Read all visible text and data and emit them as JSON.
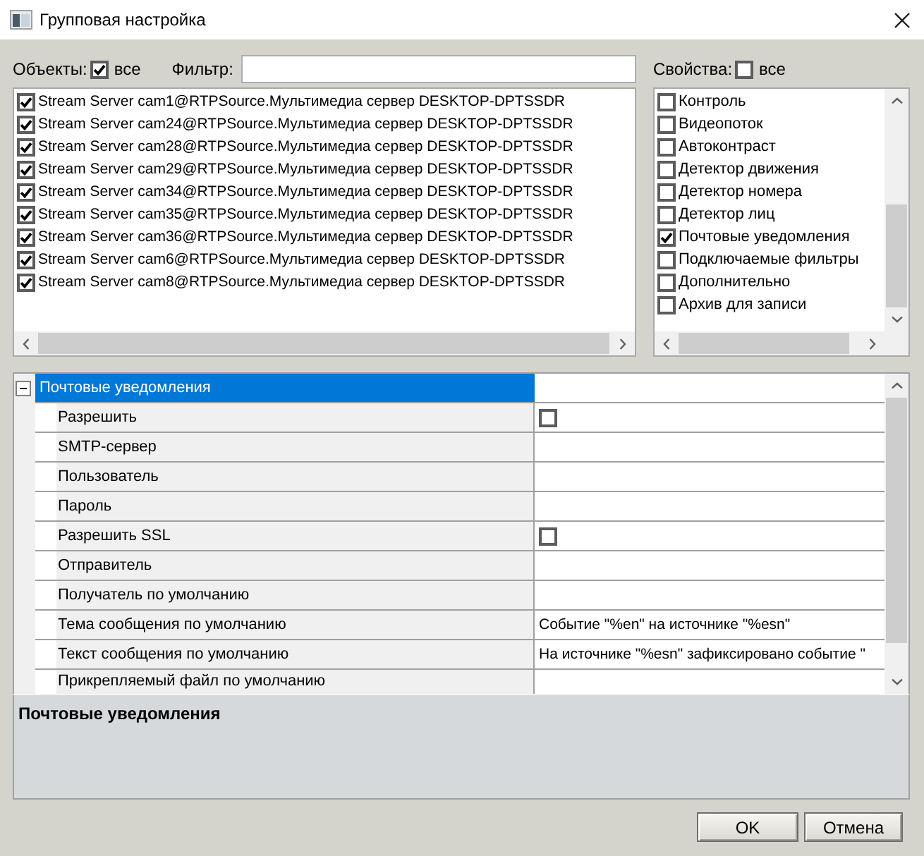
{
  "window": {
    "title": "Групповая настройка"
  },
  "objects": {
    "label": "Объекты:",
    "all": {
      "label": "все",
      "checked": true
    },
    "filter": {
      "label": "Фильтр:"
    },
    "items": [
      {
        "label": "Stream Server cam1@RTPSource.Мультимедиа сервер DESKTOP-DPTSSDR",
        "checked": true
      },
      {
        "label": "Stream Server cam24@RTPSource.Мультимедиа сервер DESKTOP-DPTSSDR",
        "checked": true
      },
      {
        "label": "Stream Server cam28@RTPSource.Мультимедиа сервер DESKTOP-DPTSSDR",
        "checked": true
      },
      {
        "label": "Stream Server cam29@RTPSource.Мультимедиа сервер DESKTOP-DPTSSDR",
        "checked": true
      },
      {
        "label": "Stream Server cam34@RTPSource.Мультимедиа сервер DESKTOP-DPTSSDR",
        "checked": true
      },
      {
        "label": "Stream Server cam35@RTPSource.Мультимедиа сервер DESKTOP-DPTSSDR",
        "checked": true
      },
      {
        "label": "Stream Server cam36@RTPSource.Мультимедиа сервер DESKTOP-DPTSSDR",
        "checked": true
      },
      {
        "label": "Stream Server cam6@RTPSource.Мультимедиа сервер DESKTOP-DPTSSDR",
        "checked": true
      },
      {
        "label": "Stream Server cam8@RTPSource.Мультимедиа сервер DESKTOP-DPTSSDR",
        "checked": true
      }
    ]
  },
  "properties": {
    "label": "Свойства:",
    "all": {
      "label": "все",
      "checked": false
    },
    "items": [
      {
        "label": "Контроль",
        "checked": false
      },
      {
        "label": "Видеопоток",
        "checked": false
      },
      {
        "label": "Автоконтраст",
        "checked": false
      },
      {
        "label": "Детектор движения",
        "checked": false
      },
      {
        "label": "Детектор номера",
        "checked": false
      },
      {
        "label": "Детектор лиц",
        "checked": false
      },
      {
        "label": "Почтовые уведомления",
        "checked": true
      },
      {
        "label": "Подключаемые фильтры",
        "checked": false
      },
      {
        "label": "Дополнительно",
        "checked": false
      },
      {
        "label": "Архив для записи",
        "checked": false
      }
    ]
  },
  "property_grid": {
    "category": {
      "label": "Почтовые уведомления",
      "expanded": true,
      "selected": true
    },
    "rows": [
      {
        "name": "Разрешить",
        "kind": "checkbox",
        "checked": false
      },
      {
        "name": "SMTP-сервер",
        "kind": "text"
      },
      {
        "name": "Пользователь",
        "kind": "text"
      },
      {
        "name": "Пароль",
        "kind": "text"
      },
      {
        "name": "Разрешить SSL",
        "kind": "checkbox",
        "checked": false
      },
      {
        "name": "Отправитель",
        "kind": "text"
      },
      {
        "name": "Получатель по умолчанию",
        "kind": "text"
      },
      {
        "name": "Тема сообщения по умолчанию",
        "kind": "text",
        "value": "Событие \"%en\" на источнике \"%esn\""
      },
      {
        "name": "Текст сообщения по умолчанию",
        "kind": "text",
        "value": "На источнике \"%esn\" зафиксировано событие \""
      },
      {
        "name": "Прикрепляемый файл по умолчанию",
        "kind": "text"
      }
    ]
  },
  "description": {
    "title": "Почтовые уведомления"
  },
  "buttons": [
    {
      "label": "OK"
    },
    {
      "label": "Отмена"
    }
  ]
}
